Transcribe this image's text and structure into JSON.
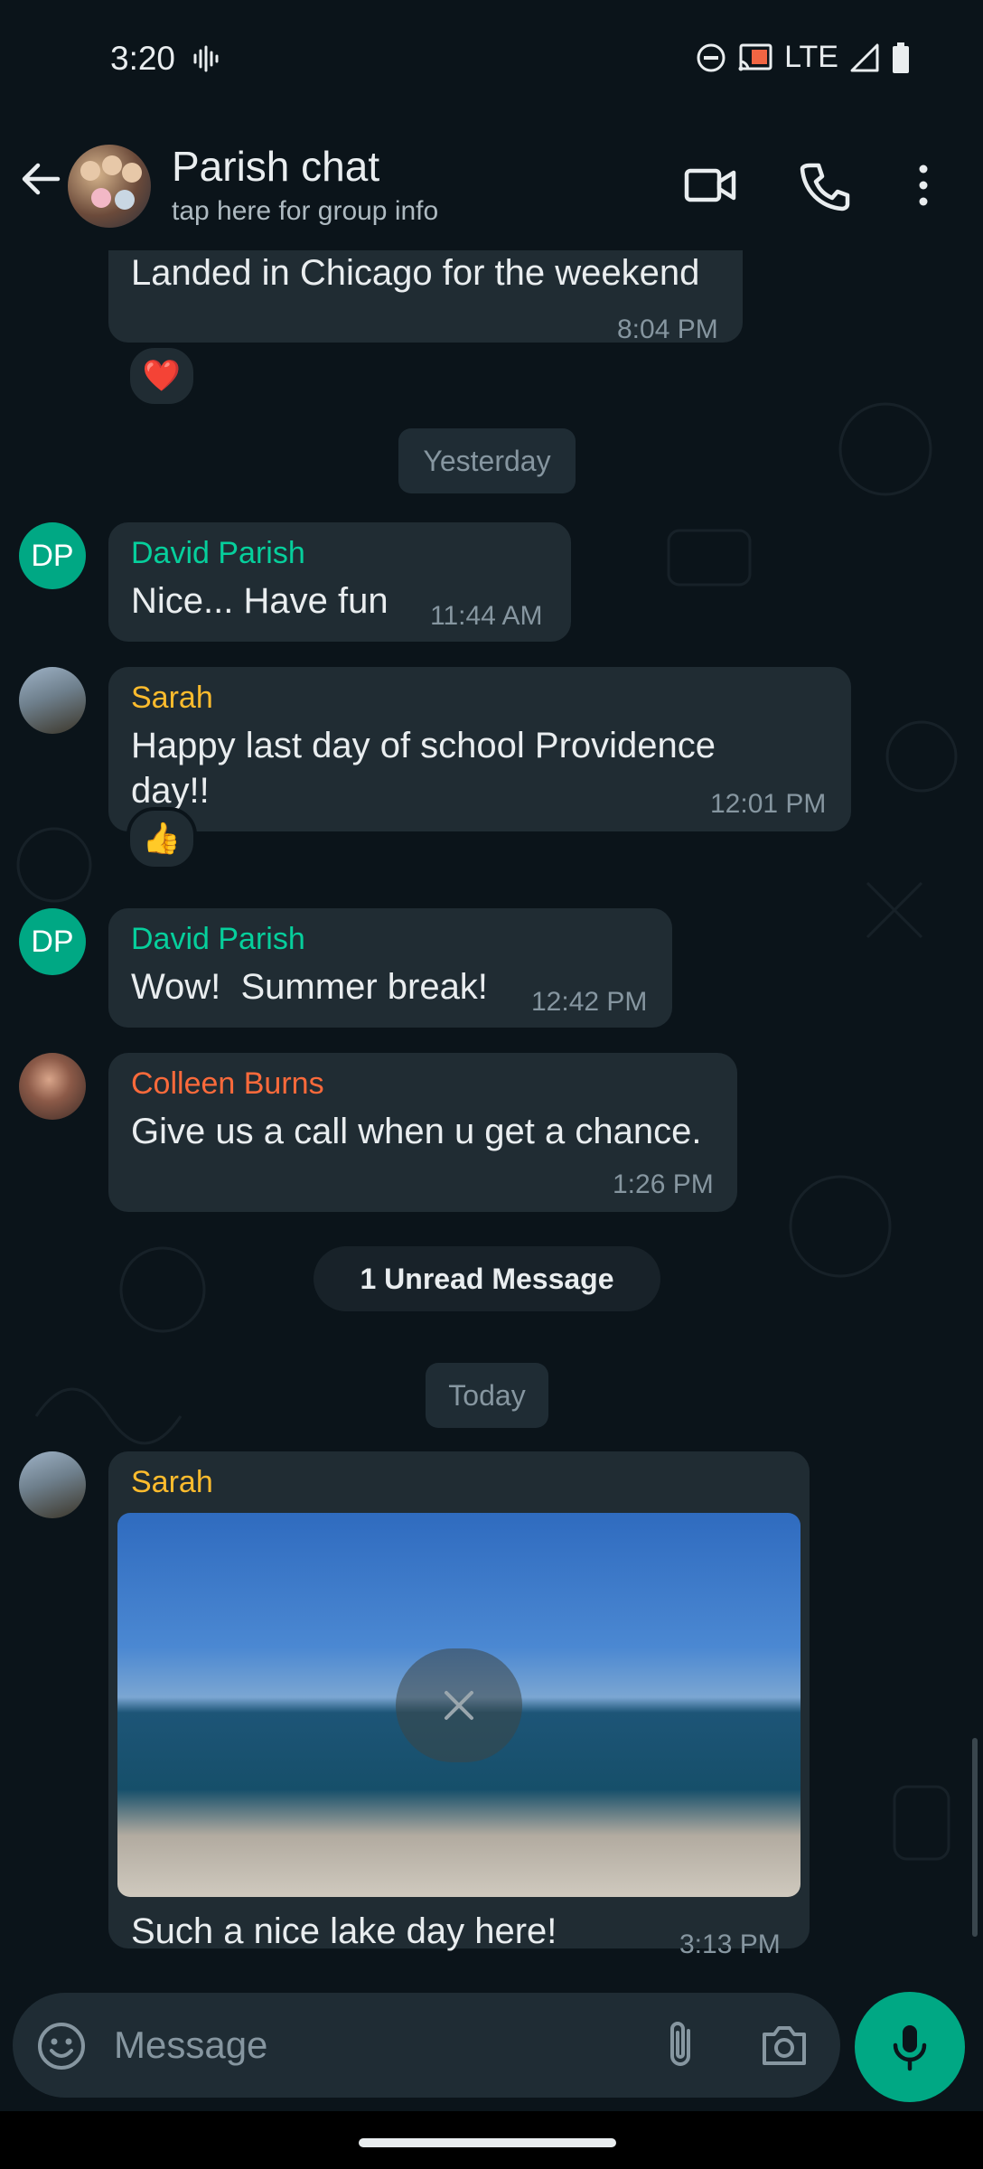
{
  "status_bar": {
    "time": "3:20",
    "network": "LTE"
  },
  "header": {
    "title": "Parish chat",
    "subtitle": "tap here for group info"
  },
  "icons": {
    "back": "arrow-left-icon",
    "video": "video-camera-icon",
    "call": "phone-icon",
    "menu": "more-vertical-icon",
    "emoji": "emoji-icon",
    "attach": "paperclip-icon",
    "camera": "camera-icon",
    "mic": "microphone-icon",
    "cancel": "close-icon"
  },
  "colors": {
    "accent": "#00a884",
    "sender_david": "#06cf9c",
    "sender_sarah": "#ffbc2d",
    "sender_colleen": "#fc6a3b",
    "bubble": "#202c33",
    "background": "#0b141a"
  },
  "messages": [
    {
      "text": "Landed in Chicago for the weekend",
      "time": "8:04 PM",
      "reaction": "❤️"
    },
    {
      "sender": "David Parish",
      "initials": "DP",
      "text": "Nice... Have fun",
      "time": "11:44 AM"
    },
    {
      "sender": "Sarah",
      "text": "Happy last day of school Providence day!!",
      "time": "12:01 PM",
      "reaction": "👍"
    },
    {
      "sender": "David Parish",
      "initials": "DP",
      "text": "Wow!  Summer break!",
      "time": "12:42 PM"
    },
    {
      "sender": "Colleen Burns",
      "text": "Give us a call when u get a chance.",
      "time": "1:26 PM"
    },
    {
      "sender": "Sarah",
      "text": "Such a nice lake day here!",
      "time": "3:13 PM"
    }
  ],
  "dividers": {
    "yesterday": "Yesterday",
    "unread": "1 Unread Message",
    "today": "Today"
  },
  "input": {
    "placeholder": "Message"
  }
}
